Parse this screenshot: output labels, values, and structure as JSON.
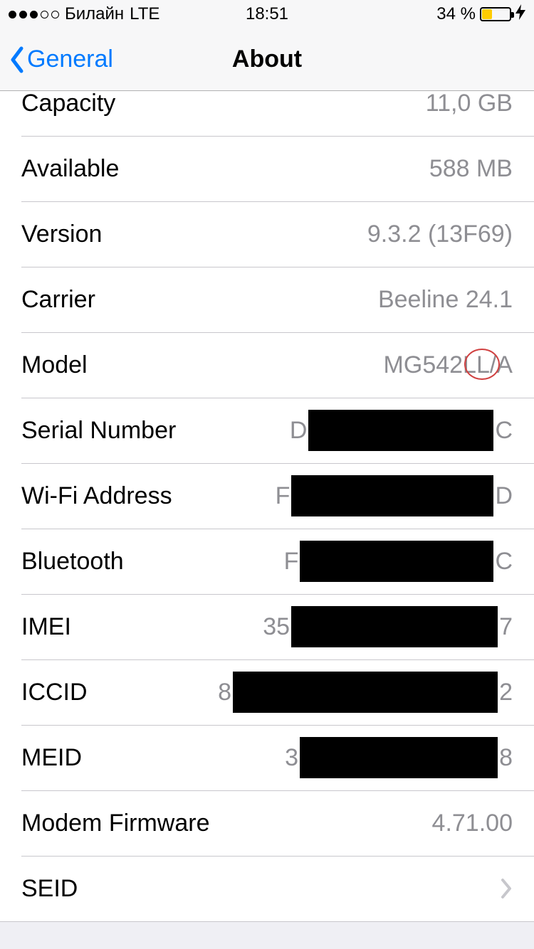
{
  "status_bar": {
    "carrier": "Билайн",
    "network": "LTE",
    "time": "18:51",
    "battery_percent_text": "34 %",
    "battery_percent": 34
  },
  "nav": {
    "back_label": "General",
    "title": "About"
  },
  "rows": {
    "capacity": {
      "label": "Capacity",
      "value": "11,0 GB"
    },
    "available": {
      "label": "Available",
      "value": "588 MB"
    },
    "version": {
      "label": "Version",
      "value": "9.3.2 (13F69)"
    },
    "carrier": {
      "label": "Carrier",
      "value": "Beeline 24.1"
    },
    "model": {
      "label": "Model",
      "value": "MG542LL/A"
    },
    "serial": {
      "label": "Serial Number",
      "prefix": "D",
      "suffix": "C",
      "redact_width": 260
    },
    "wifi": {
      "label": "Wi-Fi Address",
      "prefix": "F",
      "suffix": "D",
      "redact_width": 284
    },
    "bluetooth": {
      "label": "Bluetooth",
      "prefix": "F",
      "suffix": "C",
      "redact_width": 272
    },
    "imei": {
      "label": "IMEI",
      "prefix": "35",
      "suffix": "7",
      "redact_width": 290
    },
    "iccid": {
      "label": "ICCID",
      "prefix": "8",
      "suffix": "2",
      "redact_width": 372
    },
    "meid": {
      "label": "MEID",
      "prefix": "3",
      "suffix": "8",
      "redact_width": 278
    },
    "modem_firmware": {
      "label": "Modem Firmware",
      "value": "4.71.00"
    },
    "seid": {
      "label": "SEID"
    }
  }
}
